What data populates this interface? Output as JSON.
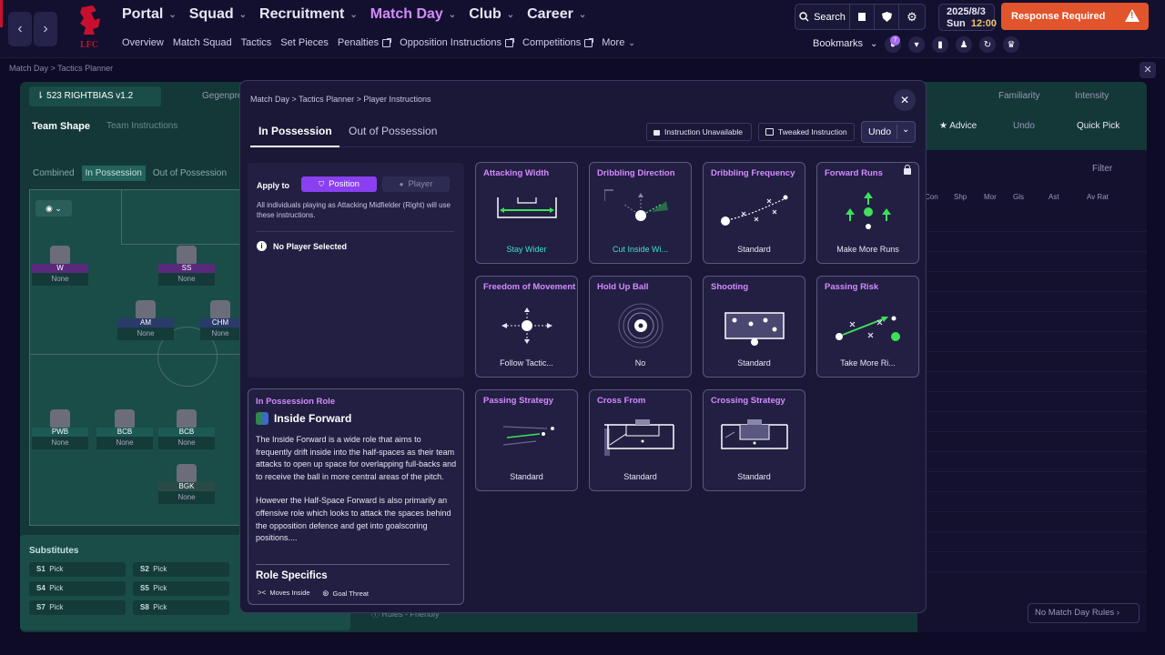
{
  "topbar": {
    "nav_main": [
      {
        "label": "Portal",
        "active": false
      },
      {
        "label": "Squad",
        "active": false
      },
      {
        "label": "Recruitment",
        "active": false
      },
      {
        "label": "Match Day",
        "active": true
      },
      {
        "label": "Club",
        "active": false
      },
      {
        "label": "Career",
        "active": false
      }
    ],
    "nav_sub": [
      "Overview",
      "Match Squad",
      "Tactics",
      "Set Pieces",
      "Penalties",
      "Opposition Instructions",
      "Competitions",
      "More"
    ],
    "search_label": "Search",
    "date": "2025/8/3",
    "day": "Sun",
    "time": "12:00",
    "response_label": "Response Required",
    "bookmarks_label": "Bookmarks",
    "notification_count": "7",
    "club_crest_text": "LFC"
  },
  "breadcrumb": [
    "Match Day",
    "Tactics Planner"
  ],
  "background": {
    "tactic_name": "523 RIGHTBIAS v1.2",
    "gegenpress": "Gegenpre",
    "familiarity": "Familiarity",
    "intensity": "Intensity",
    "tabs": [
      "Team Shape",
      "Team Instructions"
    ],
    "view_tabs": [
      "Combined",
      "In Possession",
      "Out of Possession"
    ],
    "advice": "Advice",
    "undo": "Undo",
    "quick_pick": "Quick Pick",
    "filter": "Filter",
    "col_headers": [
      "Con",
      "Shp",
      "Mor",
      "Gls",
      "Ast",
      "Av Rat"
    ],
    "players": [
      {
        "pos": "W",
        "name": "None"
      },
      {
        "pos": "SS",
        "name": "None"
      },
      {
        "pos": "AM",
        "name": "None"
      },
      {
        "pos": "CHM",
        "name": "None"
      },
      {
        "pos": "PWB",
        "name": "None"
      },
      {
        "pos": "BCB",
        "name": "None"
      },
      {
        "pos": "BCB",
        "name": "None"
      },
      {
        "pos": "BGK",
        "name": "None"
      }
    ],
    "subs_title": "Substitutes",
    "subs": [
      {
        "slot": "S1",
        "value": "Pick"
      },
      {
        "slot": "S2",
        "value": "Pick"
      },
      {
        "slot": "S4",
        "value": "Pick"
      },
      {
        "slot": "S5",
        "value": "Pick"
      },
      {
        "slot": "S7",
        "value": "Pick"
      },
      {
        "slot": "S8",
        "value": "Pick"
      }
    ],
    "rules_label": "Rules - Friendly",
    "no_match_rules": "No Match Day Rules"
  },
  "modal": {
    "breadcrumb": [
      "Match Day",
      "Tactics Planner",
      "Player Instructions"
    ],
    "tabs": [
      {
        "label": "In Possession",
        "active": true
      },
      {
        "label": "Out of Possession",
        "active": false
      }
    ],
    "legend_unavailable": "Instruction Unavailable",
    "legend_tweaked": "Tweaked Instruction",
    "undo_label": "Undo",
    "apply": {
      "label": "Apply to",
      "option_position": "Position",
      "option_player": "Player",
      "description": "All individuals playing as Attacking Midfielder (Right) will use these instructions.",
      "no_player": "No Player Selected"
    },
    "role": {
      "header": "In Possession Role",
      "name": "Inside Forward",
      "description_1": "The Inside Forward is a wide role that aims to frequently drift inside into the half-spaces as their team attacks to open up space for overlapping full-backs and to receive the ball in more central areas of the pitch.",
      "description_2": "However the Half-Space Forward is also primarily an offensive role which looks to attack the spaces behind the opposition defence and get into goalscoring positions....",
      "specifics_title": "Role Specifics",
      "specifics": [
        "Moves Inside",
        "Goal Threat"
      ]
    },
    "instructions": [
      {
        "title": "Attacking Width",
        "value": "Stay Wider",
        "modified": true,
        "locked": false
      },
      {
        "title": "Dribbling Direction",
        "value": "Cut Inside Wi...",
        "modified": true,
        "locked": false
      },
      {
        "title": "Dribbling Frequency",
        "value": "Standard",
        "modified": false,
        "locked": false
      },
      {
        "title": "Forward Runs",
        "value": "Make More Runs",
        "modified": false,
        "locked": true
      },
      {
        "title": "Freedom of Movement",
        "value": "Follow Tactic...",
        "modified": false,
        "locked": false
      },
      {
        "title": "Hold Up Ball",
        "value": "No",
        "modified": false,
        "locked": false
      },
      {
        "title": "Shooting",
        "value": "Standard",
        "modified": false,
        "locked": false
      },
      {
        "title": "Passing Risk",
        "value": "Take More Ri...",
        "modified": false,
        "locked": false
      },
      {
        "title": "Passing Strategy",
        "value": "Standard",
        "modified": false,
        "locked": false
      },
      {
        "title": "Cross From",
        "value": "Standard",
        "modified": false,
        "locked": false
      },
      {
        "title": "Crossing Strategy",
        "value": "Standard",
        "modified": false,
        "locked": false
      }
    ]
  },
  "colors": {
    "accent": "#d48bff",
    "modified": "#3fe0c8",
    "primary_button": "#8a3ff0",
    "response": "#e2542b",
    "green_arrow": "#3ee05a"
  }
}
